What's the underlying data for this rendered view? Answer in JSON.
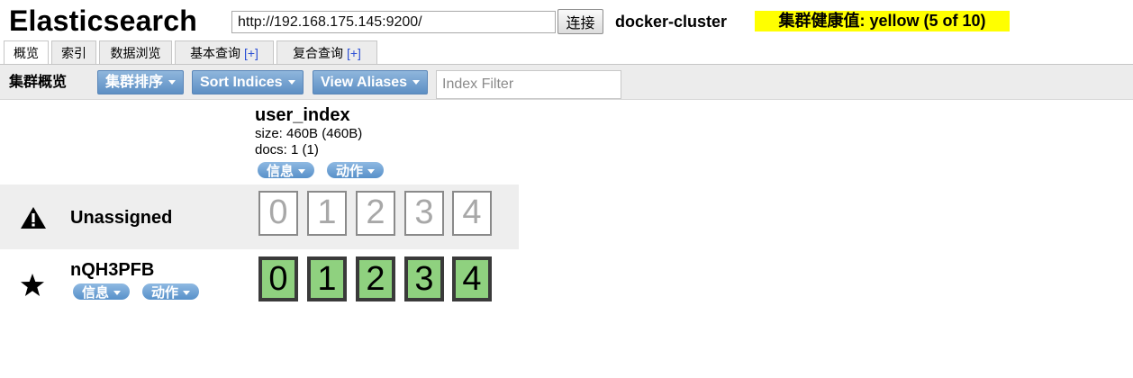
{
  "header": {
    "app_title": "Elasticsearch",
    "url": "http://192.168.175.145:9200/",
    "connect_label": "连接",
    "cluster_name": "docker-cluster",
    "health": "集群健康值: yellow (5 of 10)"
  },
  "tabs": [
    {
      "label": "概览",
      "plus": ""
    },
    {
      "label": "索引",
      "plus": ""
    },
    {
      "label": "数据浏览",
      "plus": ""
    },
    {
      "label": "基本查询",
      "plus": "[+]"
    },
    {
      "label": "复合查询",
      "plus": "[+]"
    }
  ],
  "toolbar": {
    "overview_label": "集群概览",
    "sort_cluster_label": "集群排序",
    "sort_indices_label": "Sort Indices",
    "view_aliases_label": "View Aliases",
    "filter_placeholder": "Index Filter"
  },
  "index": {
    "name": "user_index",
    "size": "size: 460B (460B)",
    "docs": "docs: 1 (1)",
    "info_label": "信息",
    "action_label": "动作"
  },
  "unassigned": {
    "label": "Unassigned",
    "shards": [
      "0",
      "1",
      "2",
      "3",
      "4"
    ]
  },
  "node": {
    "name": "nQH3PFB",
    "info_label": "信息",
    "action_label": "动作",
    "shards": [
      "0",
      "1",
      "2",
      "3",
      "4"
    ]
  },
  "colors": {
    "health": "#ffff00",
    "shard_assigned": "#8fd17f",
    "button": "#6a9bd0"
  },
  "icons": {
    "unassigned": "warning-icon",
    "node": "star-icon"
  }
}
